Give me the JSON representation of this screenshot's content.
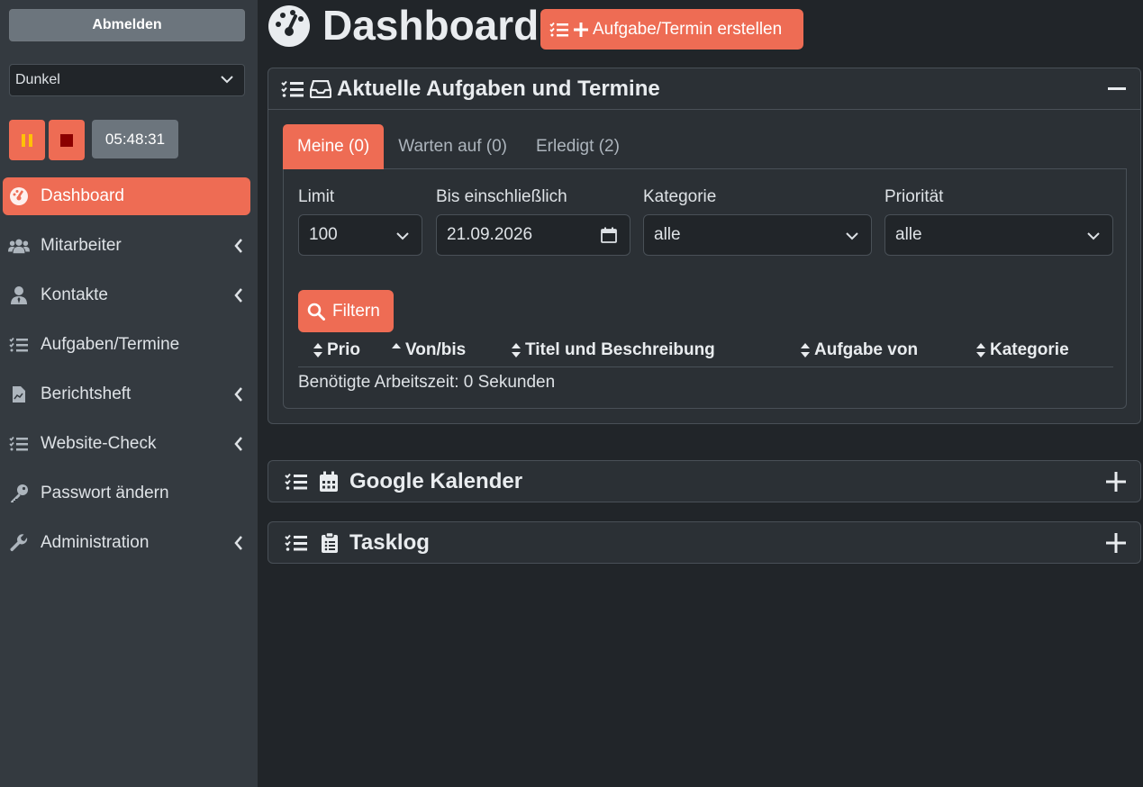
{
  "sidebar": {
    "logout_label": "Abmelden",
    "theme_value": "Dunkel",
    "timer": "05:48:31",
    "nav": [
      {
        "label": "Dashboard"
      },
      {
        "label": "Mitarbeiter"
      },
      {
        "label": "Kontakte"
      },
      {
        "label": "Aufgaben/Termine"
      },
      {
        "label": "Berichtsheft"
      },
      {
        "label": "Website-Check"
      },
      {
        "label": "Passwort ändern"
      },
      {
        "label": "Administration"
      }
    ]
  },
  "header": {
    "title": "Dashboard",
    "create_label": "Aufgabe/Termin erstellen"
  },
  "tasks_card": {
    "title": "Aktuelle Aufgaben und Termine",
    "tabs": [
      {
        "label": "Meine (0)"
      },
      {
        "label": "Warten auf (0)"
      },
      {
        "label": "Erledigt (2)"
      }
    ],
    "filters": {
      "limit_label": "Limit",
      "limit_value": "100",
      "until_label": "Bis einschließlich",
      "until_value": "21.09.2026",
      "category_label": "Kategorie",
      "category_value": "alle",
      "priority_label": "Priorität",
      "priority_value": "alle",
      "filter_button": "Filtern"
    },
    "columns": [
      "Prio",
      "Von/bis",
      "Titel und Beschreibung",
      "Aufgabe von",
      "Kategorie"
    ],
    "worktime": "Benötigte Arbeitszeit: 0 Sekunden"
  },
  "calendar_card": {
    "title": "Google Kalender"
  },
  "tasklog_card": {
    "title": "Tasklog"
  },
  "colors": {
    "accent": "#ee6c54",
    "sidebar_bg": "#343a40",
    "page_bg": "#212529"
  }
}
